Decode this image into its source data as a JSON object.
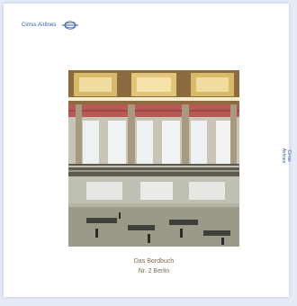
{
  "brand": {
    "name": "Cirrus Airlines",
    "logo_icon": "cirrus-airlines-logo-icon",
    "accent": "#2a5aa6"
  },
  "cover": {
    "photo": "airport-terminal-hall-photo",
    "title_line1": "Das Bordbuch",
    "title_line2": "Nr. 2 Berlin",
    "title_color": "#7a6a52"
  },
  "spine": {
    "line1": "Cirrus",
    "line2": "Airlines"
  }
}
